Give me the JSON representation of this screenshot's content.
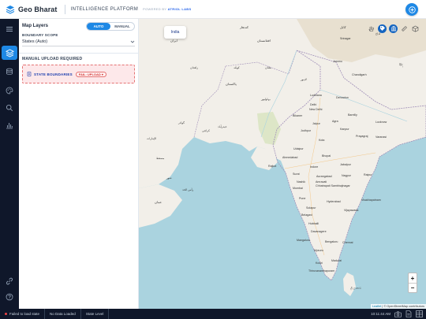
{
  "header": {
    "brand": "Geo Bharat",
    "platform": "INTELLIGENCE PLATFORM",
    "powered_prefix": "POWERED BY",
    "powered_by": "ATRIOL LABS"
  },
  "panel": {
    "title": "Map Layers",
    "mode_options": [
      "AUTO",
      "MANUAL"
    ],
    "active_mode": "AUTO",
    "boundary_scope_label": "BOUNDARY SCOPE",
    "boundary_scope_value": "States (Auto)",
    "manual_upload_title": "MANUAL UPLOAD REQUIRED",
    "state_boundaries_label": "STATE BOUNDARIES",
    "fail_chip": "FAIL: UPLOAD ▾"
  },
  "map": {
    "tooltip": "India",
    "zoom_in": "+",
    "zoom_out": "−",
    "attribution_leaflet": "Leaflet",
    "attribution_rest": "| © OpenStreetMap contributors",
    "labels": {
      "srinagar": "Srinagar",
      "ladakh": "لداخ",
      "jammu": "Jammu",
      "ludhiana": "Ludhiana",
      "dehradun": "Dehradun",
      "chandigarh": "Chandigarh",
      "new_delhi": "New Delhi",
      "delhi": "Delhi",
      "jaipur": "Jaipur",
      "agra": "Agra",
      "bareilly": "Bareilly",
      "lucknow": "Lucknow",
      "kanpur": "Kanpur",
      "prayagraj": "Prayagraj",
      "varanasi": "Varanasi",
      "kota": "Kota",
      "bikaner": "Bikaner",
      "jodhpur": "Jodhpur",
      "udaipur": "Udaipur",
      "ahmedabad": "Ahmedabad",
      "rajkot": "Rajkot",
      "surat": "Surat",
      "bhopal": "Bhopal",
      "jabalpur": "Jabalpur",
      "indore": "Indore",
      "nagpur": "Nagpur",
      "raipur": "Raipur",
      "mumbai": "Mumbai",
      "pune": "Pune",
      "nashik": "Nashik",
      "aurangabad": "Aurangabad",
      "amravati": "Amravati",
      "chhatrapati_sambhajinagar": "Chhatrapati Sambhajinagar",
      "hyderabad": "Hyderabad",
      "solapur": "Solapur",
      "vijayawada": "Vijayawada",
      "visakhapatnam": "Visakhapatnam",
      "belagavi": "Belagavi",
      "hubballi": "Hubballi",
      "davanagere": "Davanagere",
      "bengaluru": "Bengaluru",
      "mangaluru": "Mangaluru",
      "chennai": "Chennai",
      "mysuru": "Mysuru",
      "kochi": "Kochi",
      "thiruvananthapuram": "Thiruvananthapuram",
      "madurai": "Madurai",
      "karachi": "كراچی",
      "multan": "ملتان",
      "lahore": "لاہور",
      "quetta": "کوئٹہ",
      "bahawalpur": "بہاولپور",
      "hyderabad_pk": "حیدرآباد",
      "oman": "عمان",
      "muscat": "مسقط",
      "zahedan": "زاهدان",
      "kandahar": "کندهار",
      "kabul": "کابل",
      "iran": "ایران",
      "afghanistan": "افغانستان",
      "pakistan": "پاکستان",
      "sri_lanka": "ශ්‍රී ලංකාව",
      "tibet": "བོད་",
      "uae": "الإمارات",
      "gwadar": "گوادر",
      "sur": "صور",
      "ras_al_hadd": "رأس الحد"
    }
  },
  "status": {
    "error": "Failed to load state",
    "data": "No Data Loaded",
    "level": "State Level",
    "time": "10:11:44 AM"
  },
  "colors": {
    "accent": "#1e88e5",
    "rail": "#0f172a",
    "error": "#d32f2f",
    "sea": "#aad3df",
    "land": "#f2efe9"
  },
  "icons": {
    "rail": [
      "menu-icon",
      "layers-icon",
      "database-icon",
      "palette-icon",
      "search-icon",
      "bar-chart-icon",
      "link-icon",
      "help-icon"
    ],
    "map_tools": [
      "hand-icon",
      "tag-icon",
      "columns-icon",
      "ruler-icon",
      "cube-icon"
    ],
    "status": [
      "camera-icon",
      "document-icon",
      "table-icon"
    ]
  }
}
